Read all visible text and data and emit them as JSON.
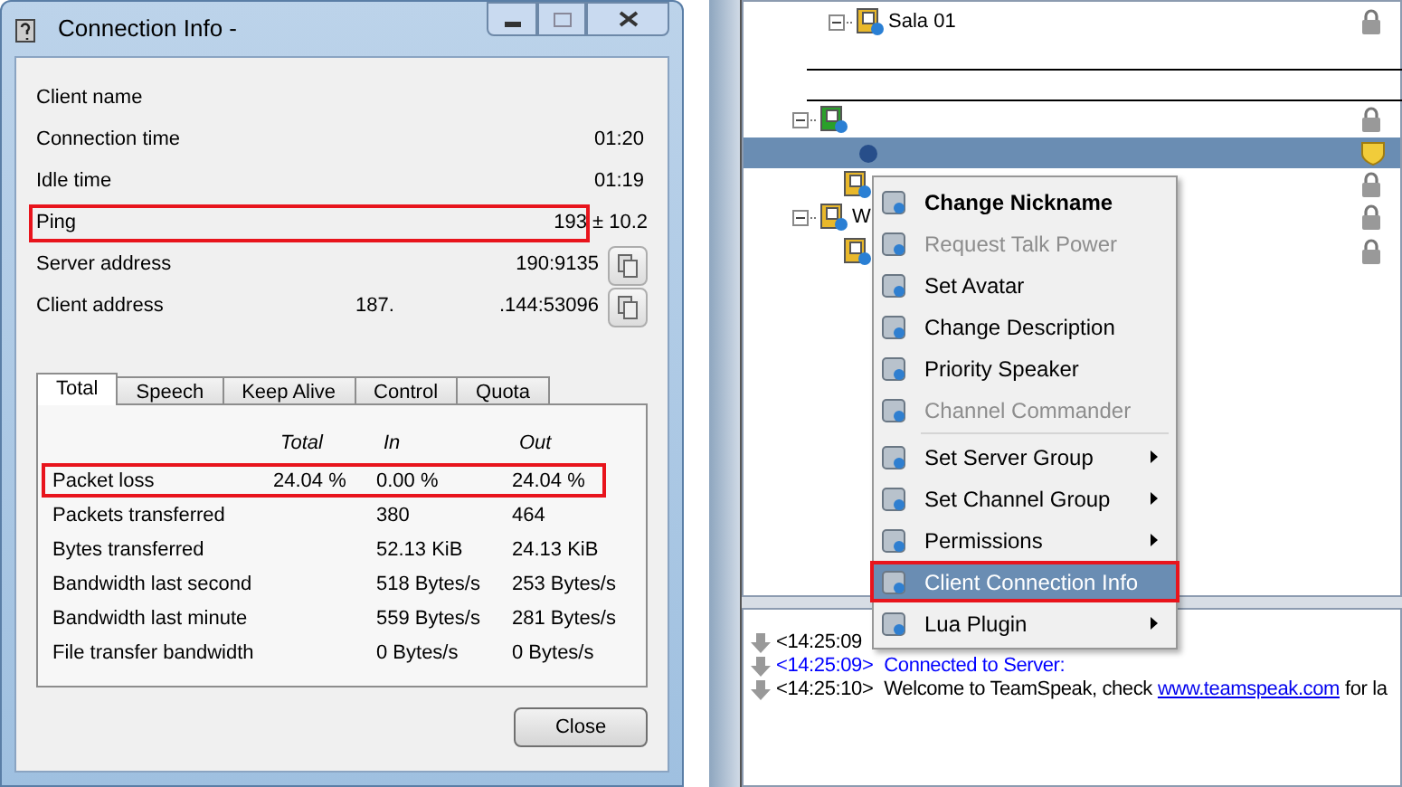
{
  "dialog": {
    "title": "Connection Info -",
    "info_rows": [
      {
        "label": "Client name",
        "highlighted": false
      },
      {
        "label": "Connection time",
        "value": "01:20",
        "highlighted": false
      },
      {
        "label": "Idle time",
        "value": "01:19",
        "highlighted": false
      },
      {
        "label": "Ping",
        "value": "193",
        "extra": "± 10.2",
        "highlighted": true
      },
      {
        "label": "Server address",
        "value": "190:9135",
        "copy": true,
        "highlighted": false
      },
      {
        "label": "Client address",
        "value": "187.",
        "value2": ".144:53096",
        "copy": true,
        "highlighted": false
      }
    ],
    "tabs": [
      {
        "label": "Total",
        "selected": true
      },
      {
        "label": "Speech",
        "selected": false
      },
      {
        "label": "Keep Alive",
        "selected": false
      },
      {
        "label": "Control",
        "selected": false
      },
      {
        "label": "Quota",
        "selected": false
      }
    ],
    "table": {
      "columns": [
        "Total",
        "In",
        "Out"
      ],
      "rows": [
        {
          "label": "Packet loss",
          "total": "24.04 %",
          "in": "0.00 %",
          "out": "24.04 %",
          "highlighted": true
        },
        {
          "label": "Packets transferred",
          "in": "380",
          "out": "464",
          "highlighted": false
        },
        {
          "label": "Bytes transferred",
          "in": "52.13 KiB",
          "out": "24.13 KiB",
          "highlighted": false
        },
        {
          "label": "Bandwidth last second",
          "in": "518 Bytes/s",
          "out": "253 Bytes/s",
          "highlighted": false
        },
        {
          "label": "Bandwidth last minute",
          "in": "559 Bytes/s",
          "out": "281 Bytes/s",
          "highlighted": false
        },
        {
          "label": "File transfer bandwidth",
          "in": "0 Bytes/s",
          "out": "0 Bytes/s",
          "highlighted": false
        }
      ]
    },
    "close_button": "Close"
  },
  "tree": {
    "items": [
      {
        "kind": "nested_channel",
        "label": "Sala 01",
        "selected": false
      },
      {
        "kind": "spacer",
        "selected": false
      },
      {
        "kind": "spacer",
        "selected": false
      },
      {
        "kind": "channel",
        "selected": false
      },
      {
        "kind": "client",
        "selected": true
      },
      {
        "kind": "subchannel",
        "selected": false
      },
      {
        "kind": "channel",
        "label": "W",
        "selected": false
      },
      {
        "kind": "subchannel",
        "selected": false
      }
    ]
  },
  "context_menu": [
    {
      "kind": "item",
      "label": "Change Nickname",
      "bold": true,
      "disabled": false,
      "selected": false,
      "submenu": false,
      "highlighted": false
    },
    {
      "kind": "item",
      "label": "Request Talk Power",
      "bold": false,
      "disabled": true,
      "selected": false,
      "submenu": false,
      "highlighted": false
    },
    {
      "kind": "item",
      "label": "Set Avatar",
      "bold": false,
      "disabled": false,
      "selected": false,
      "submenu": false,
      "highlighted": false
    },
    {
      "kind": "item",
      "label": "Change Description",
      "bold": false,
      "disabled": false,
      "selected": false,
      "submenu": false,
      "highlighted": false
    },
    {
      "kind": "item",
      "label": "Priority Speaker",
      "bold": false,
      "disabled": false,
      "selected": false,
      "submenu": false,
      "highlighted": false
    },
    {
      "kind": "item",
      "label": "Channel Commander",
      "bold": false,
      "disabled": true,
      "selected": false,
      "submenu": false,
      "highlighted": false
    },
    {
      "kind": "separator"
    },
    {
      "kind": "item",
      "label": "Set Server Group",
      "bold": false,
      "disabled": false,
      "selected": false,
      "submenu": true,
      "highlighted": false
    },
    {
      "kind": "item",
      "label": "Set Channel Group",
      "bold": false,
      "disabled": false,
      "selected": false,
      "submenu": true,
      "highlighted": false
    },
    {
      "kind": "item",
      "label": "Permissions",
      "bold": false,
      "disabled": false,
      "selected": false,
      "submenu": true,
      "highlighted": false
    },
    {
      "kind": "item",
      "label": "Client Connection Info",
      "bold": false,
      "disabled": false,
      "selected": true,
      "submenu": false,
      "highlighted": true
    },
    {
      "kind": "item",
      "label": "Lua Plugin",
      "bold": false,
      "disabled": false,
      "selected": false,
      "submenu": true,
      "highlighted": false
    }
  ],
  "log": [
    {
      "time": "<14:25:09",
      "color": "#000000"
    },
    {
      "time": "<14:25:09>",
      "message": "Connected to Server:",
      "color": "#0000ff"
    },
    {
      "time": "<14:25:10>",
      "message": "Welcome to TeamSpeak, check",
      "link": "www.teamspeak.com",
      "after": "for la",
      "color": "#000000"
    }
  ]
}
